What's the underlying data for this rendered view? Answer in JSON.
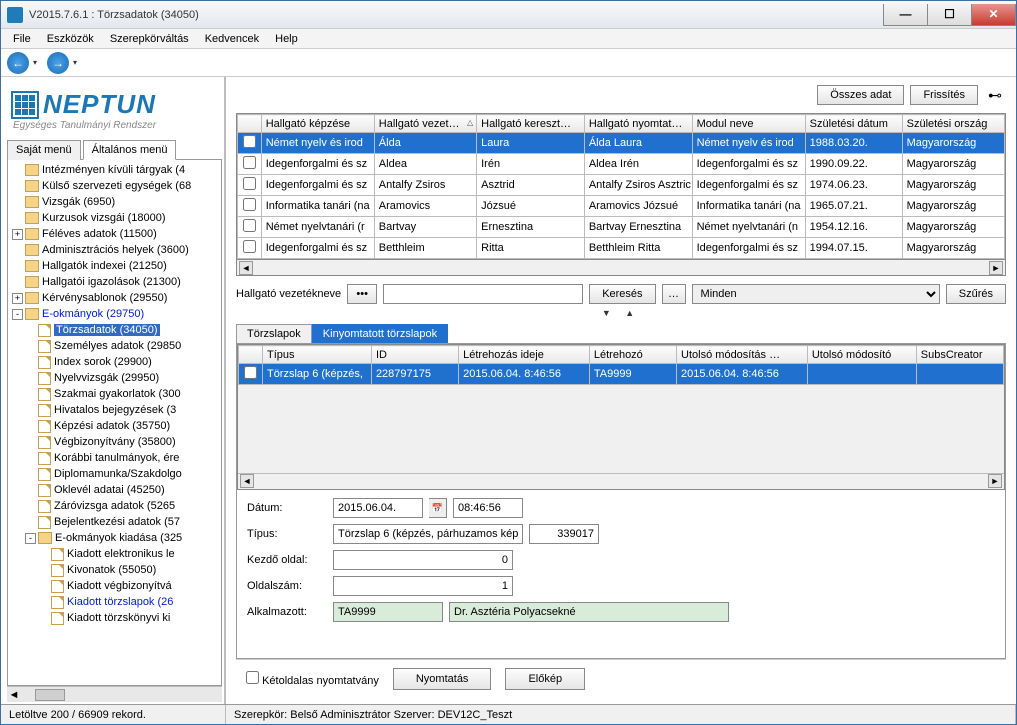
{
  "window": {
    "title": "V2015.7.6.1 : Törzsadatok (34050)"
  },
  "menu": {
    "file": "File",
    "tools": "Eszközök",
    "role": "Szerepkörváltás",
    "fav": "Kedvencek",
    "help": "Help"
  },
  "logo": {
    "main": "NEPTUN",
    "sub": "Egységes Tanulmányi Rendszer"
  },
  "left_tabs": {
    "own": "Saját menü",
    "general": "Általános menü"
  },
  "tree": [
    {
      "d": 1,
      "exp": "",
      "t": "Intézményen kívüli tárgyak (4"
    },
    {
      "d": 1,
      "exp": "",
      "t": "Külső szervezeti egységek (68"
    },
    {
      "d": 1,
      "exp": "",
      "t": "Vizsgák (6950)"
    },
    {
      "d": 1,
      "exp": "",
      "t": "Kurzusok vizsgái (18000)"
    },
    {
      "d": 1,
      "exp": "+",
      "t": "Féléves adatok (11500)"
    },
    {
      "d": 1,
      "exp": "",
      "t": "Adminisztrációs helyek (3600)"
    },
    {
      "d": 1,
      "exp": "",
      "t": "Hallgatók indexei (21250)"
    },
    {
      "d": 1,
      "exp": "",
      "t": "Hallgatói igazolások (21300)"
    },
    {
      "d": 1,
      "exp": "+",
      "t": "Kérvénysablonok (29550)"
    },
    {
      "d": 1,
      "exp": "-",
      "blue": true,
      "t": "E-okmányok (29750)"
    },
    {
      "d": 2,
      "exp": "",
      "sel": true,
      "doc": true,
      "t": "Törzsadatok (34050)"
    },
    {
      "d": 2,
      "exp": "",
      "doc": true,
      "t": "Személyes adatok (29850"
    },
    {
      "d": 2,
      "exp": "",
      "doc": true,
      "t": "Index sorok (29900)"
    },
    {
      "d": 2,
      "exp": "",
      "doc": true,
      "t": "Nyelvvizsgák (29950)"
    },
    {
      "d": 2,
      "exp": "",
      "doc": true,
      "t": "Szakmai gyakorlatok (300"
    },
    {
      "d": 2,
      "exp": "",
      "doc": true,
      "t": "Hivatalos bejegyzések (3"
    },
    {
      "d": 2,
      "exp": "",
      "doc": true,
      "t": "Képzési adatok (35750)"
    },
    {
      "d": 2,
      "exp": "",
      "doc": true,
      "t": "Végbizonyítvány (35800)"
    },
    {
      "d": 2,
      "exp": "",
      "doc": true,
      "t": "Korábbi tanulmányok, ére"
    },
    {
      "d": 2,
      "exp": "",
      "doc": true,
      "t": "Diplomamunka/Szakdolgo"
    },
    {
      "d": 2,
      "exp": "",
      "doc": true,
      "t": "Oklevél adatai (45250)"
    },
    {
      "d": 2,
      "exp": "",
      "doc": true,
      "t": "Záróvizsga adatok (5265"
    },
    {
      "d": 2,
      "exp": "",
      "doc": true,
      "t": "Bejelentkezési adatok (57"
    },
    {
      "d": 2,
      "exp": "-",
      "t": "E-okmányok kiadása (325"
    },
    {
      "d": 3,
      "exp": "",
      "doc": true,
      "t": "Kiadott elektronikus le"
    },
    {
      "d": 3,
      "exp": "",
      "doc": true,
      "t": "Kivonatok (55050)"
    },
    {
      "d": 3,
      "exp": "",
      "doc": true,
      "t": "Kiadott végbizonyítvá"
    },
    {
      "d": 3,
      "exp": "",
      "blue": true,
      "doc": true,
      "t": "Kiadott törzslapok (26"
    },
    {
      "d": 3,
      "exp": "",
      "doc": true,
      "t": "Kiadott törzskönyvi ki"
    }
  ],
  "topbtn": {
    "all": "Összes adat",
    "refresh": "Frissítés"
  },
  "grid": {
    "cols": [
      "Hallgató képzése",
      "Hallgató vezet…",
      "Hallgató kereszt…",
      "Hallgató nyomtat…",
      "Modul neve",
      "Születési dátum",
      "Születési ország"
    ],
    "rows": [
      [
        "Német nyelv és irod",
        "Álda",
        "Laura",
        "Álda Laura",
        "Német nyelv és irod",
        "1988.03.20.",
        "Magyarország"
      ],
      [
        "Idegenforgalmi és sz",
        "Aldea",
        "Irén",
        "Aldea Irén",
        "Idegenforgalmi és sz",
        "1990.09.22.",
        "Magyarország"
      ],
      [
        "Idegenforgalmi és sz",
        "Antalfy Zsiros",
        "Asztrid",
        "Antalfy Zsiros Asztric",
        "Idegenforgalmi és sz",
        "1974.06.23.",
        "Magyarország"
      ],
      [
        "Informatika tanári (na",
        "Aramovics",
        "Józsué",
        "Aramovics Józsué",
        "Informatika tanári (na",
        "1965.07.21.",
        "Magyarország"
      ],
      [
        "Német nyelvtanári (r",
        "Bartvay",
        "Ernesztina",
        "Bartvay Ernesztina",
        "Német nyelvtanári (n",
        "1954.12.16.",
        "Magyarország"
      ],
      [
        "Idegenforgalmi és sz",
        "Betthleim",
        "Ritta",
        "Betthleim Ritta",
        "Idegenforgalmi és sz",
        "1994.07.15.",
        "Magyarország"
      ]
    ]
  },
  "search": {
    "label": "Hallgató vezetékneve",
    "keres": "Keresés",
    "dots": "…",
    "minden": "Minden",
    "filter": "Szűrés"
  },
  "detail_tabs": {
    "t1": "Törzslapok",
    "t2": "Kinyomtatott törzslapok"
  },
  "sub_grid": {
    "cols": [
      "Típus",
      "ID",
      "Létrehozás ideje",
      "Létrehozó",
      "Utolsó módosítás …",
      "Utolsó módosító",
      "SubsCreator"
    ],
    "row": [
      "Törzslap 6 (képzés,",
      "228797175",
      "2015.06.04. 8:46:56",
      "TA9999",
      "2015.06.04. 8:46:56",
      "",
      ""
    ]
  },
  "form": {
    "date_lbl": "Dátum:",
    "date": "2015.06.04.",
    "time": "08:46:56",
    "type_lbl": "Típus:",
    "type": "Törzslap 6 (képzés, párhuzamos kép",
    "typeid": "339017",
    "start_lbl": "Kezdő oldal:",
    "start": "0",
    "pages_lbl": "Oldalszám:",
    "pages": "1",
    "emp_lbl": "Alkalmazott:",
    "emp_code": "TA9999",
    "emp_name": "Dr. Asztéria Polyacsekné"
  },
  "actions": {
    "duplex": "Kétoldalas nyomtatvány",
    "print": "Nyomtatás",
    "preview": "Előkép"
  },
  "status": {
    "left": "Letöltve 200 / 66909 rekord.",
    "role": "Szerepkör: Belső Adminisztrátor  Szerver: DEV12C_Teszt"
  }
}
